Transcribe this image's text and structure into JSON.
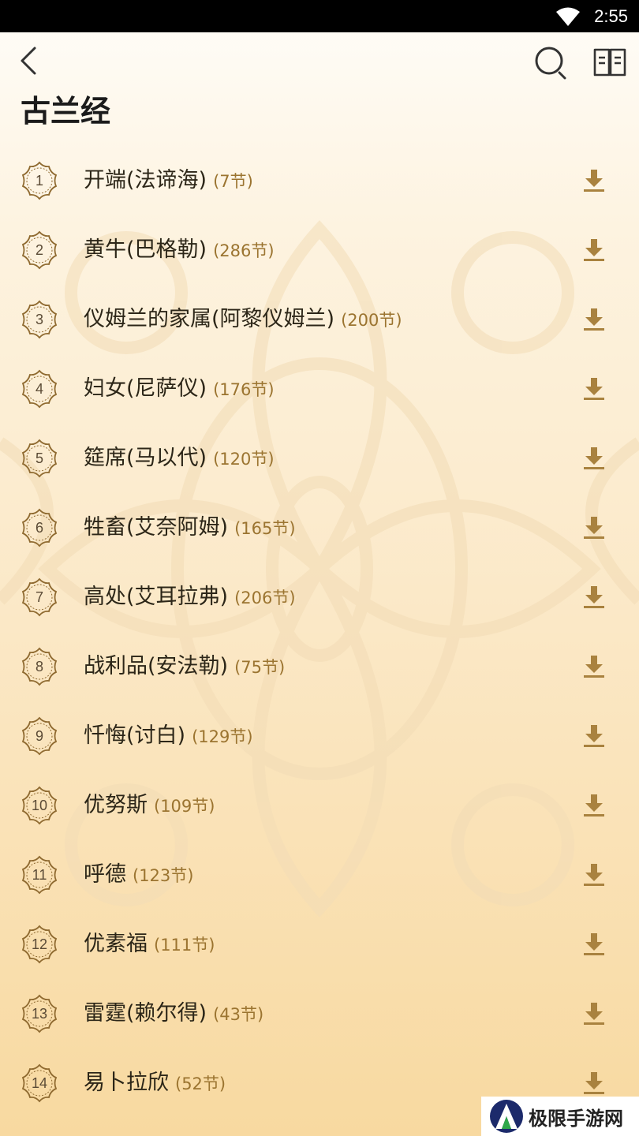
{
  "status_bar": {
    "time": "2:55"
  },
  "header": {
    "title": "古兰经"
  },
  "chapters": [
    {
      "num": "1",
      "name": "开端(法谛海)",
      "count": "(7节)"
    },
    {
      "num": "2",
      "name": "黄牛(巴格勒)",
      "count": "(286节)"
    },
    {
      "num": "3",
      "name": "仪姆兰的家属(阿黎仪姆兰)",
      "count": "(200节)"
    },
    {
      "num": "4",
      "name": "妇女(尼萨仪)",
      "count": "(176节)"
    },
    {
      "num": "5",
      "name": "筵席(马以代)",
      "count": "(120节)"
    },
    {
      "num": "6",
      "name": "牲畜(艾奈阿姆)",
      "count": "(165节)"
    },
    {
      "num": "7",
      "name": "高处(艾耳拉弗)",
      "count": "(206节)"
    },
    {
      "num": "8",
      "name": "战利品(安法勒)",
      "count": "(75节)"
    },
    {
      "num": "9",
      "name": "忏悔(讨白)",
      "count": "(129节)"
    },
    {
      "num": "10",
      "name": "优努斯",
      "count": "(109节)"
    },
    {
      "num": "11",
      "name": "呼德",
      "count": "(123节)"
    },
    {
      "num": "12",
      "name": "优素福",
      "count": "(111节)"
    },
    {
      "num": "13",
      "name": "雷霆(赖尔得)",
      "count": "(43节)"
    },
    {
      "num": "14",
      "name": "易卜拉欣",
      "count": "(52节)"
    }
  ],
  "watermark": {
    "text": "极限手游网"
  },
  "colors": {
    "accent": "#a9823f",
    "badge_stroke": "#8f6a30",
    "title": "#1b1b1b"
  },
  "icons": [
    "wifi-icon",
    "back-arrow-icon",
    "search-icon",
    "book-icon",
    "download-icon",
    "ornament-badge-icon"
  ]
}
